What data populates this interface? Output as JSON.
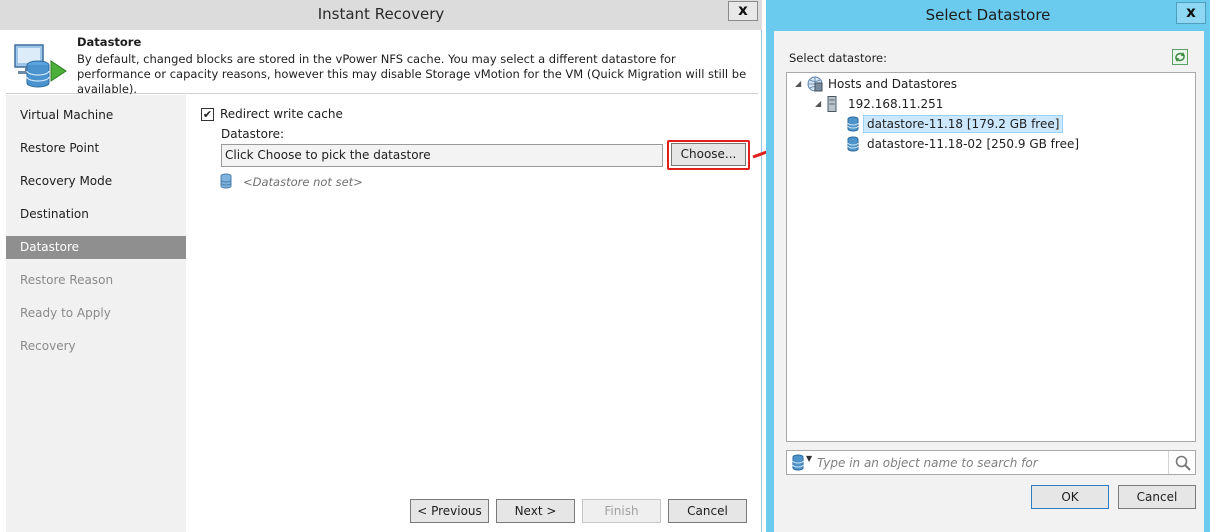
{
  "instant_recovery": {
    "title": "Instant Recovery",
    "close": "x",
    "header": {
      "title": "Datastore",
      "description": "By default, changed blocks are stored in the vPower NFS cache. You may select a different datastore for performance or capacity reasons, however this may disable Storage vMotion for the VM (Quick Migration will still be available)."
    },
    "steps": [
      {
        "label": "Virtual Machine",
        "state": "done"
      },
      {
        "label": "Restore Point",
        "state": "done"
      },
      {
        "label": "Recovery Mode",
        "state": "done"
      },
      {
        "label": "Destination",
        "state": "done"
      },
      {
        "label": "Datastore",
        "state": "active"
      },
      {
        "label": "Restore Reason",
        "state": "pending"
      },
      {
        "label": "Ready to Apply",
        "state": "pending"
      },
      {
        "label": "Recovery",
        "state": "pending"
      }
    ],
    "redirect_checkbox": {
      "label": "Redirect write cache",
      "checked": "✔"
    },
    "datastore_label": "Datastore:",
    "datastore_value": "Click Choose to pick the datastore",
    "choose_button": "Choose...",
    "datastore_status": "<Datastore not set>",
    "buttons": {
      "previous": "< Previous",
      "next": "Next >",
      "finish": "Finish",
      "cancel": "Cancel"
    }
  },
  "select_datastore": {
    "title": "Select Datastore",
    "close": "x",
    "label": "Select datastore:",
    "tree": {
      "root": "Hosts and Datastores",
      "host": "192.168.11.251",
      "datastores": [
        "datastore-11.18 [179.2 GB free]",
        "datastore-11.18-02 [250.9 GB free]"
      ],
      "selected_index": 0
    },
    "search_placeholder": "Type in an object name to search for",
    "ok": "OK",
    "cancel": "Cancel"
  },
  "colors": {
    "accent_titlebar": "#6bcbee",
    "highlight": "#e0201a",
    "active_step": "#8f8f8f",
    "selection": "#cce8ff"
  }
}
